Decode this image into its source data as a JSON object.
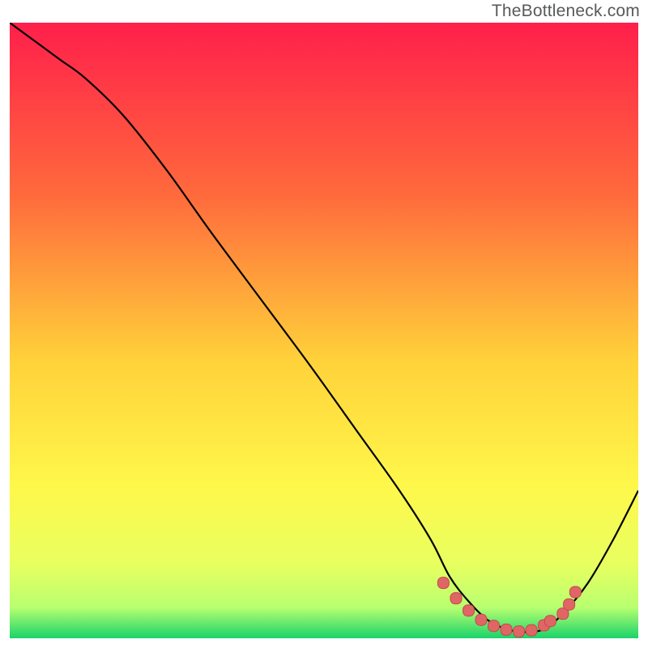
{
  "watermark": "TheBottleneck.com",
  "colors": {
    "grad_top": "#ff1f4b",
    "grad_mid1": "#ff6a3c",
    "grad_mid2": "#ffd23a",
    "grad_mid3": "#fff74a",
    "grad_low1": "#e8ff60",
    "grad_low2": "#b8ff70",
    "grad_bottom": "#1bd36b",
    "curve": "#000000",
    "marker_fill": "#e06666",
    "marker_stroke": "#c44848"
  },
  "chart_data": {
    "type": "line",
    "title": "",
    "xlabel": "",
    "ylabel": "",
    "xlim": [
      0,
      100
    ],
    "ylim": [
      0,
      100
    ],
    "x": [
      0,
      4,
      8,
      12,
      18,
      25,
      32,
      40,
      48,
      55,
      62,
      67,
      70,
      73,
      76,
      79,
      82,
      85,
      88,
      92,
      96,
      100
    ],
    "values": [
      100,
      97,
      94,
      91,
      85,
      76,
      66,
      55,
      44,
      34,
      24,
      16,
      10,
      6,
      3,
      1.5,
      1,
      1.5,
      4,
      9,
      16,
      24
    ],
    "markers_x": [
      69,
      71,
      73,
      75,
      77,
      79,
      81,
      83,
      85,
      86,
      88,
      89,
      90
    ],
    "markers_y": [
      9,
      6.5,
      4.5,
      3,
      2,
      1.4,
      1.1,
      1.3,
      2.1,
      2.8,
      4,
      5.5,
      7.5
    ],
    "annotations": []
  }
}
